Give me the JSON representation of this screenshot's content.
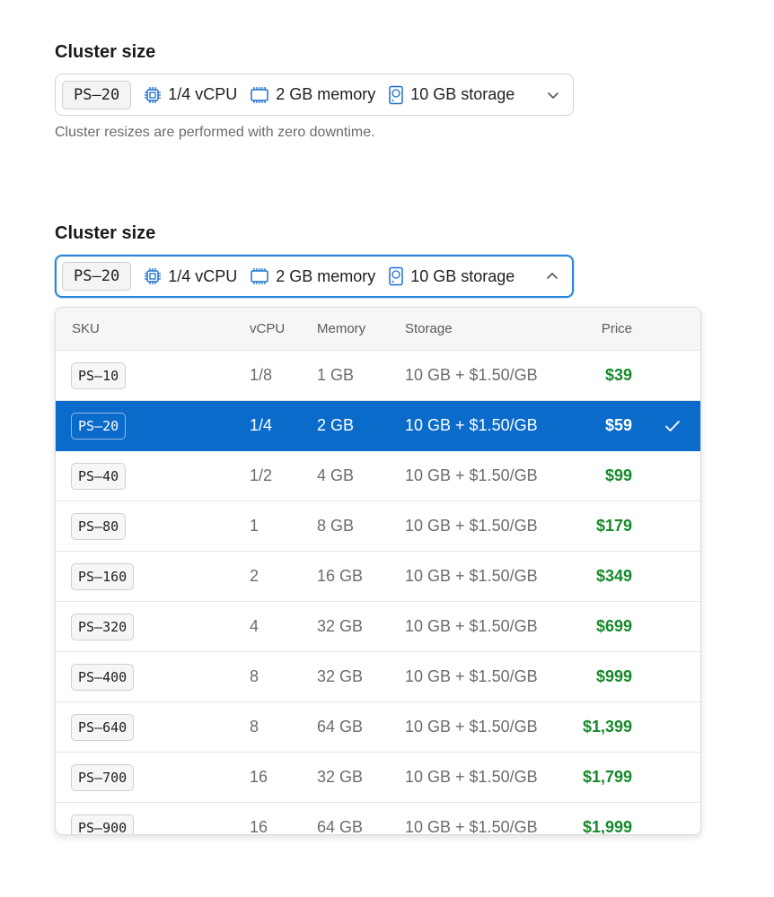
{
  "colors": {
    "accent": "#0b6bcb",
    "focus_border": "#2a86d8",
    "price_green": "#168a2b"
  },
  "closed_picker": {
    "label": "Cluster size",
    "sku": "PS–20",
    "vcpu": "1/4 vCPU",
    "memory": "2 GB memory",
    "storage": "10 GB storage",
    "hint": "Cluster resizes are performed with zero downtime.",
    "icons": [
      "cpu-icon",
      "memory-icon",
      "storage-icon",
      "chevron-down-icon"
    ]
  },
  "open_picker": {
    "label": "Cluster size",
    "sku": "PS–20",
    "vcpu": "1/4 vCPU",
    "memory": "2 GB memory",
    "storage": "10 GB storage",
    "icons": [
      "cpu-icon",
      "memory-icon",
      "storage-icon",
      "chevron-up-icon"
    ]
  },
  "table": {
    "headers": {
      "sku": "SKU",
      "vcpu": "vCPU",
      "memory": "Memory",
      "storage": "Storage",
      "price": "Price"
    },
    "selected_sku": "PS–20",
    "rows": [
      {
        "sku": "PS–10",
        "vcpu": "1/8",
        "memory": "1 GB",
        "storage": "10 GB + $1.50/GB",
        "price": "$39"
      },
      {
        "sku": "PS–20",
        "vcpu": "1/4",
        "memory": "2 GB",
        "storage": "10 GB + $1.50/GB",
        "price": "$59"
      },
      {
        "sku": "PS–40",
        "vcpu": "1/2",
        "memory": "4 GB",
        "storage": "10 GB + $1.50/GB",
        "price": "$99"
      },
      {
        "sku": "PS–80",
        "vcpu": "1",
        "memory": "8 GB",
        "storage": "10 GB + $1.50/GB",
        "price": "$179"
      },
      {
        "sku": "PS–160",
        "vcpu": "2",
        "memory": "16 GB",
        "storage": "10 GB + $1.50/GB",
        "price": "$349"
      },
      {
        "sku": "PS–320",
        "vcpu": "4",
        "memory": "32 GB",
        "storage": "10 GB + $1.50/GB",
        "price": "$699"
      },
      {
        "sku": "PS–400",
        "vcpu": "8",
        "memory": "32 GB",
        "storage": "10 GB + $1.50/GB",
        "price": "$999"
      },
      {
        "sku": "PS–640",
        "vcpu": "8",
        "memory": "64 GB",
        "storage": "10 GB + $1.50/GB",
        "price": "$1,399"
      },
      {
        "sku": "PS–700",
        "vcpu": "16",
        "memory": "32 GB",
        "storage": "10 GB + $1.50/GB",
        "price": "$1,799"
      },
      {
        "sku": "PS–900",
        "vcpu": "16",
        "memory": "64 GB",
        "storage": "10 GB + $1.50/GB",
        "price": "$1,999"
      }
    ]
  }
}
